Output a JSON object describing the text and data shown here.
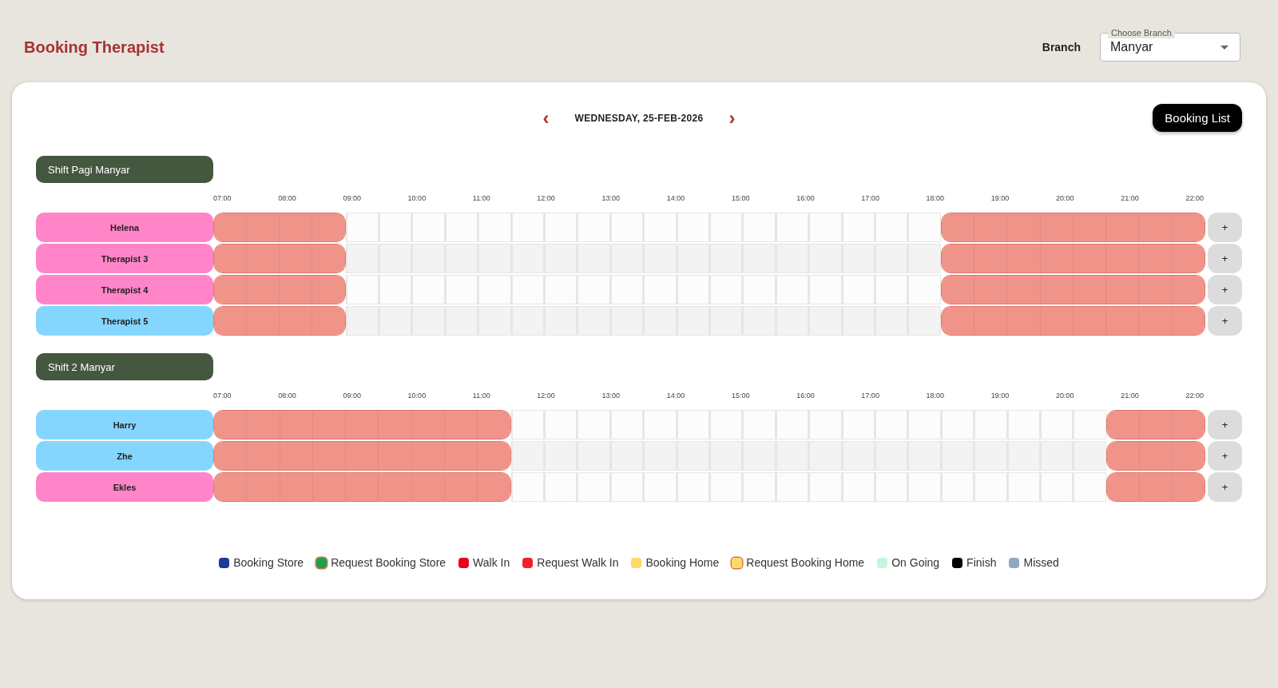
{
  "page_title": "Booking Therapist",
  "branch": {
    "label": "Branch",
    "field_label": "Choose Branch",
    "value": "Manyar"
  },
  "date_nav": {
    "prev": "‹",
    "date": "WEDNESDAY, 25-FEB-2026",
    "next": "›"
  },
  "booking_list_button": "Booking List",
  "shifts": [
    {
      "name": "Shift Pagi Manyar",
      "times": [
        "07:00",
        "08:00",
        "09:00",
        "10:00",
        "11:00",
        "12:00",
        "13:00",
        "14:00",
        "15:00",
        "16:00",
        "17:00",
        "18:00",
        "19:00",
        "20:00",
        "21:00",
        "22:00"
      ],
      "therapists": [
        {
          "name": "Helena",
          "color": "#ff85c8",
          "add": "+",
          "booked": [
            true,
            true,
            true,
            true,
            false,
            false,
            false,
            false,
            false,
            false,
            false,
            false,
            false,
            false,
            false,
            false,
            false,
            false,
            false,
            false,
            false,
            false,
            true,
            true,
            true,
            true,
            true,
            true,
            true,
            true
          ]
        },
        {
          "name": "Therapist 3",
          "color": "#ff85c8",
          "add": "+",
          "booked": [
            true,
            true,
            true,
            true,
            false,
            false,
            false,
            false,
            false,
            false,
            false,
            false,
            false,
            false,
            false,
            false,
            false,
            false,
            false,
            false,
            false,
            false,
            true,
            true,
            true,
            true,
            true,
            true,
            true,
            true
          ]
        },
        {
          "name": "Therapist 4",
          "color": "#ff85c8",
          "add": "+",
          "booked": [
            true,
            true,
            true,
            true,
            false,
            false,
            false,
            false,
            false,
            false,
            false,
            false,
            false,
            false,
            false,
            false,
            false,
            false,
            false,
            false,
            false,
            false,
            true,
            true,
            true,
            true,
            true,
            true,
            true,
            true
          ]
        },
        {
          "name": "Therapist 5",
          "color": "#85d6ff",
          "add": "+",
          "booked": [
            true,
            true,
            true,
            true,
            false,
            false,
            false,
            false,
            false,
            false,
            false,
            false,
            false,
            false,
            false,
            false,
            false,
            false,
            false,
            false,
            false,
            false,
            true,
            true,
            true,
            true,
            true,
            true,
            true,
            true
          ]
        }
      ]
    },
    {
      "name": "Shift 2 Manyar",
      "times": [
        "07:00",
        "08:00",
        "09:00",
        "10:00",
        "11:00",
        "12:00",
        "13:00",
        "14:00",
        "15:00",
        "16:00",
        "17:00",
        "18:00",
        "19:00",
        "20:00",
        "21:00",
        "22:00"
      ],
      "therapists": [
        {
          "name": "Harry",
          "color": "#85d6ff",
          "add": "+",
          "booked": [
            true,
            true,
            true,
            true,
            true,
            true,
            true,
            true,
            true,
            false,
            false,
            false,
            false,
            false,
            false,
            false,
            false,
            false,
            false,
            false,
            false,
            false,
            false,
            false,
            false,
            false,
            false,
            true,
            true,
            true
          ]
        },
        {
          "name": "Zhe",
          "color": "#85d6ff",
          "add": "+",
          "booked": [
            true,
            true,
            true,
            true,
            true,
            true,
            true,
            true,
            true,
            false,
            false,
            false,
            false,
            false,
            false,
            false,
            false,
            false,
            false,
            false,
            false,
            false,
            false,
            false,
            false,
            false,
            false,
            true,
            true,
            true
          ]
        },
        {
          "name": "Ekles",
          "color": "#ff85c8",
          "add": "+",
          "booked": [
            true,
            true,
            true,
            true,
            true,
            true,
            true,
            true,
            true,
            false,
            false,
            false,
            false,
            false,
            false,
            false,
            false,
            false,
            false,
            false,
            false,
            false,
            false,
            false,
            false,
            false,
            false,
            true,
            true,
            true
          ]
        }
      ]
    }
  ],
  "legend": [
    {
      "label": "Booking Store",
      "color": "#1a3a9c",
      "outlined": false
    },
    {
      "label": "Request Booking Store",
      "color": "#1fa04a",
      "outlined": true
    },
    {
      "label": "Walk In",
      "color": "#e8001c",
      "outlined": false
    },
    {
      "label": "Request Walk In",
      "color": "#f2202a",
      "outlined": false
    },
    {
      "label": "Booking Home",
      "color": "#fcd96a",
      "outlined": false
    },
    {
      "label": "Request Booking Home",
      "color": "#fcd96a",
      "outlined": true
    },
    {
      "label": "On Going",
      "color": "#c5f5dc",
      "outlined": false
    },
    {
      "label": "Finish",
      "color": "#000000",
      "outlined": false
    },
    {
      "label": "Missed",
      "color": "#8fa8c0",
      "outlined": false
    }
  ]
}
